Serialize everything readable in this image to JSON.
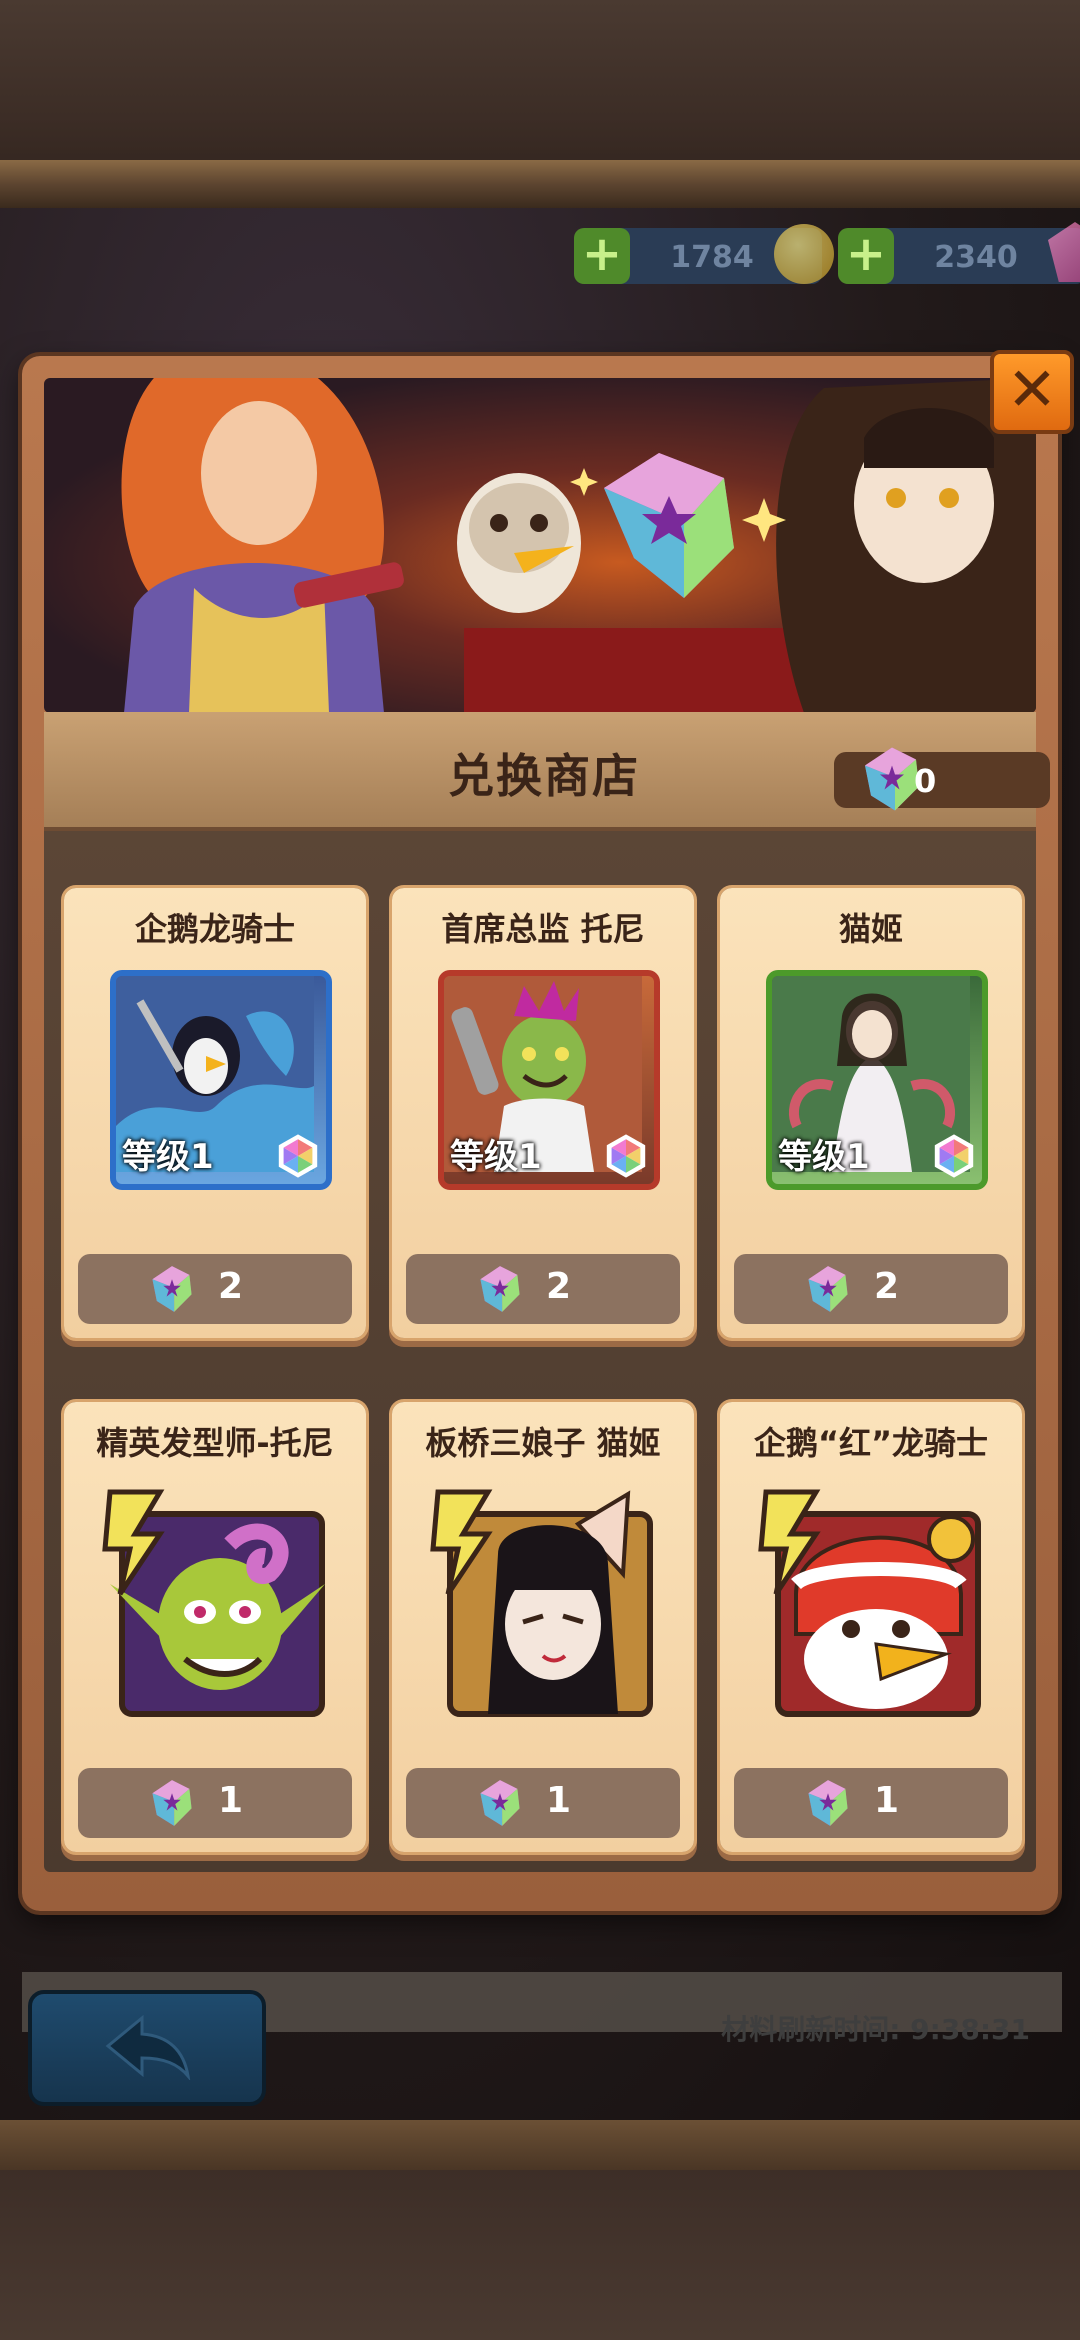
{
  "currency": {
    "coins": "1784",
    "gems": "2340",
    "plus_label": "+"
  },
  "shop": {
    "title": "兑换商店",
    "gem_balance": "0",
    "close_label": "✕"
  },
  "cards": [
    {
      "name": "企鹅龙骑士",
      "level": "等级1",
      "price": "2",
      "frame": "blue"
    },
    {
      "name": "首席总监 托尼",
      "level": "等级1",
      "price": "2",
      "frame": "red"
    },
    {
      "name": "猫姬",
      "level": "等级1",
      "price": "2",
      "frame": "green"
    },
    {
      "name": "精英发型师-托尼",
      "price": "1"
    },
    {
      "name": "板桥三娘子 猫姬",
      "price": "1"
    },
    {
      "name": "企鹅“红”龙骑士",
      "price": "1"
    }
  ],
  "footer": {
    "refresh_text": "材料刷新时间: 9:38:31"
  }
}
